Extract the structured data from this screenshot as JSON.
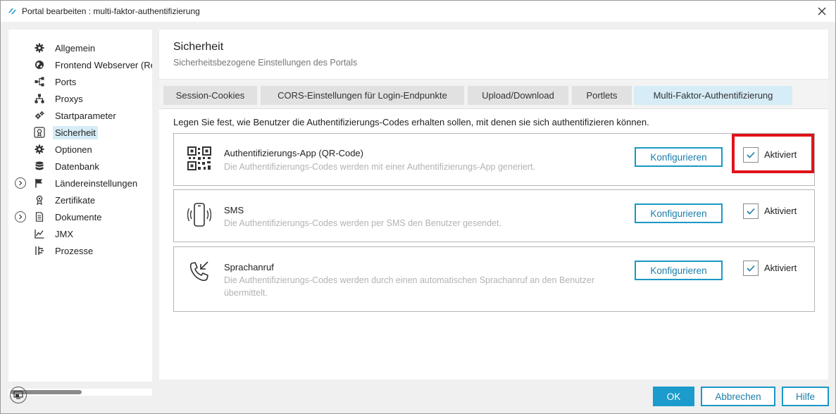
{
  "window": {
    "title": "Portal bearbeiten : multi-faktor-authentifizierung",
    "close_icon": "close-icon"
  },
  "sidebar": {
    "items": [
      {
        "label": "Allgemein",
        "icon": "gear-icon"
      },
      {
        "label": "Frontend Webserver (Re",
        "icon": "globe-icon"
      },
      {
        "label": "Ports",
        "icon": "ports-icon"
      },
      {
        "label": "Proxys",
        "icon": "proxy-icon"
      },
      {
        "label": "Startparameter",
        "icon": "gears-icon"
      },
      {
        "label": "Sicherheit",
        "icon": "security-icon",
        "selected": true
      },
      {
        "label": "Optionen",
        "icon": "gear-icon"
      },
      {
        "label": "Datenbank",
        "icon": "database-icon"
      },
      {
        "label": "Ländereinstellungen",
        "icon": "flag-icon",
        "expandable": true
      },
      {
        "label": "Zertifikate",
        "icon": "certificate-icon"
      },
      {
        "label": "Dokumente",
        "icon": "document-icon",
        "expandable": true
      },
      {
        "label": "JMX",
        "icon": "chart-icon"
      },
      {
        "label": "Prozesse",
        "icon": "process-icon"
      }
    ]
  },
  "header": {
    "title": "Sicherheit",
    "subtitle": "Sicherheitsbezogene Einstellungen des Portals"
  },
  "tabs": [
    {
      "label": "Session-Cookies",
      "active": false
    },
    {
      "label": "CORS-Einstellungen für Login-Endpunkte",
      "active": false
    },
    {
      "label": "Upload/Download",
      "active": false
    },
    {
      "label": "Portlets",
      "active": false
    },
    {
      "label": "Multi-Faktor-Authentifizierung",
      "active": true
    }
  ],
  "mfa": {
    "intro": "Legen Sie fest, wie Benutzer die Authentifizierungs-Codes erhalten sollen, mit denen sie sich authentifizieren können.",
    "methods": [
      {
        "title": "Authentifizierungs-App (QR-Code)",
        "description": "Die Authentifizierungs-Codes werden mit einer Authentifizierungs-App generiert.",
        "icon": "qr-code-icon",
        "button_label": "Konfigurieren",
        "checkbox_label": "Aktiviert",
        "checked": true,
        "highlighted": true
      },
      {
        "title": "SMS",
        "description": "Die Authentifizierungs-Codes werden per SMS den Benutzer gesendet.",
        "icon": "smartphone-icon",
        "button_label": "Konfigurieren",
        "checkbox_label": "Aktiviert",
        "checked": true,
        "highlighted": false
      },
      {
        "title": "Sprachanruf",
        "description": "Die Authentifizierungs-Codes werden durch einen automatischen Sprachanruf an den Benutzer übermittelt.",
        "icon": "incoming-call-icon",
        "button_label": "Konfigurieren",
        "checkbox_label": "Aktiviert",
        "checked": true,
        "highlighted": false
      }
    ]
  },
  "footer": {
    "ok_label": "OK",
    "cancel_label": "Abbrechen",
    "help_label": "Hilfe"
  },
  "colors": {
    "accent": "#1b9ccc",
    "selection": "#d6ecf7",
    "highlight": "#e0131a"
  }
}
